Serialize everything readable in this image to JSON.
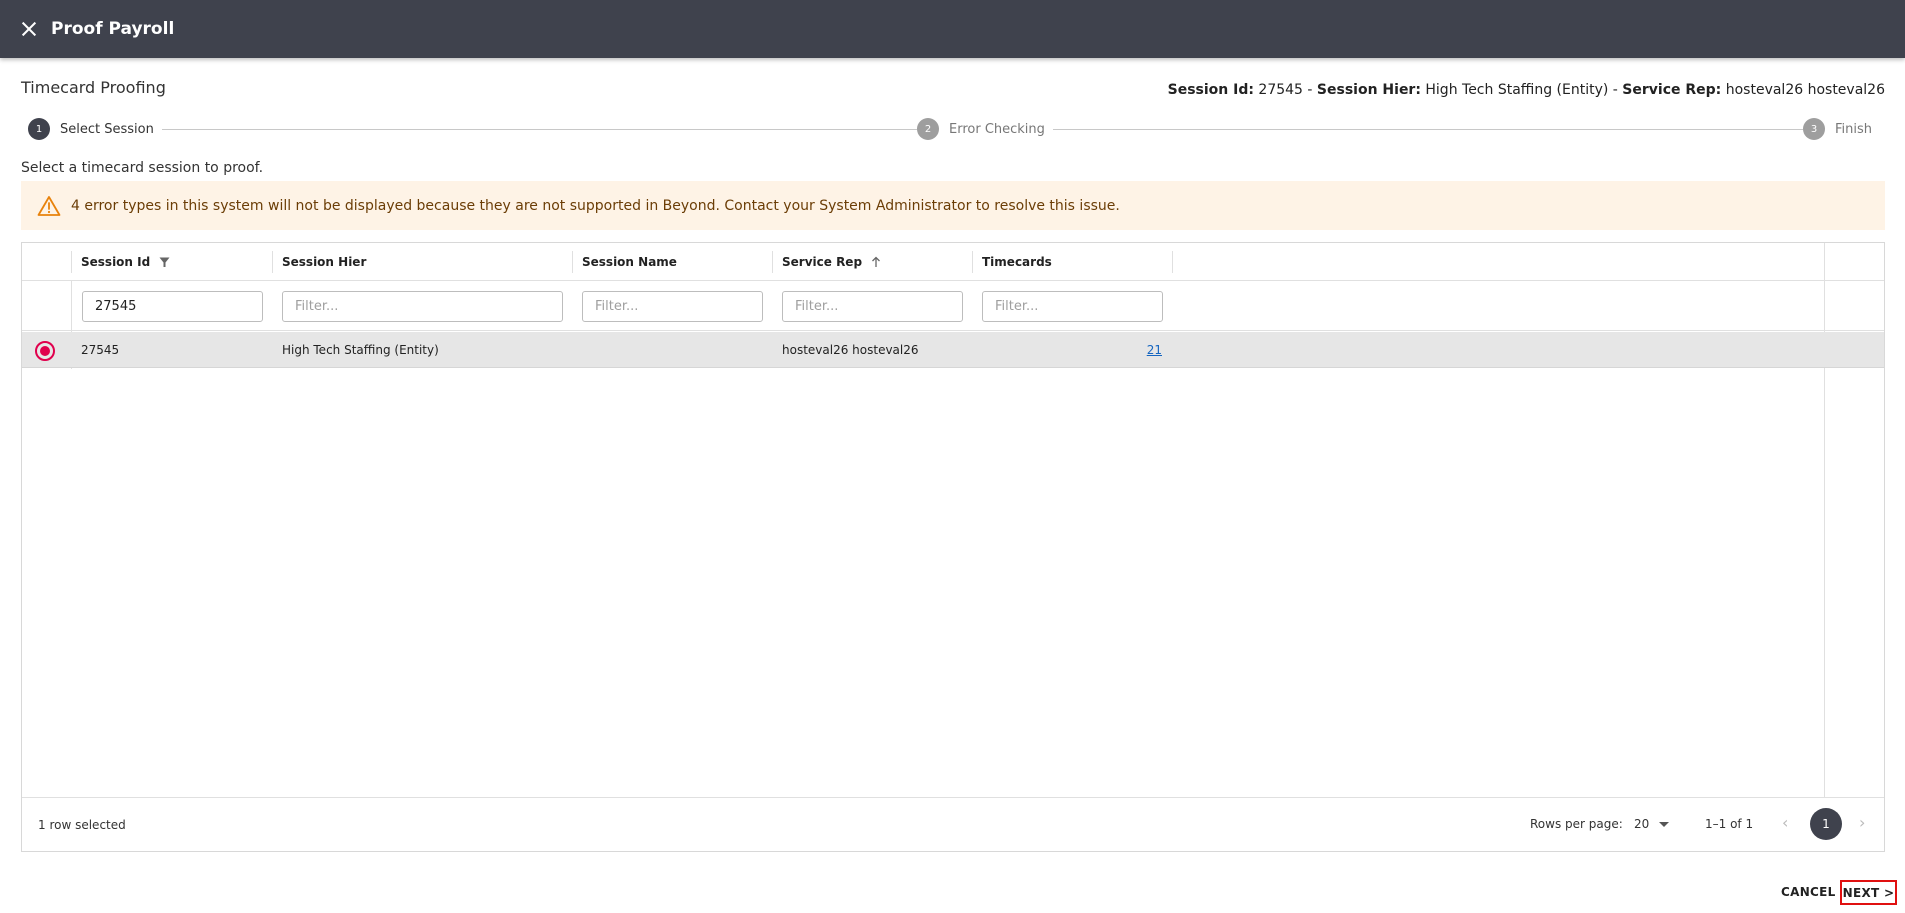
{
  "header": {
    "title": "Proof Payroll",
    "close_icon": "close-icon"
  },
  "page": {
    "section_title": "Timecard Proofing",
    "session_info": {
      "session_id_label": "Session Id:",
      "session_id_value": "27545",
      "separator": "-",
      "session_hier_label": "Session Hier:",
      "session_hier_value": "High Tech Staffing (Entity)",
      "service_rep_label": "Service Rep:",
      "service_rep_value": "hosteval26 hosteval26"
    },
    "stepper": [
      {
        "number": "1",
        "label": "Select Session",
        "state": "active"
      },
      {
        "number": "2",
        "label": "Error Checking",
        "state": "inactive"
      },
      {
        "number": "3",
        "label": "Finish",
        "state": "inactive"
      }
    ],
    "instruction": "Select a timecard session to proof.",
    "warning": {
      "icon": "warning-icon",
      "text": "4 error types in this system will not be displayed because they are not supported in Beyond. Contact your System Administrator to resolve this issue.",
      "bg_color": "#fef3e6",
      "icon_color": "#e8820c"
    }
  },
  "grid": {
    "columns": [
      {
        "label": "Session Id",
        "icon": "filter-icon"
      },
      {
        "label": "Session Hier",
        "icon": ""
      },
      {
        "label": "Session Name",
        "icon": ""
      },
      {
        "label": "Service Rep",
        "icon": "sort-ascending-icon"
      },
      {
        "label": "Timecards",
        "icon": ""
      }
    ],
    "filters": {
      "session_id_value": "27545",
      "placeholder": "Filter..."
    },
    "rows": [
      {
        "selected": true,
        "session_id": "27545",
        "session_hier": "High Tech Staffing (Entity)",
        "session_name": "",
        "service_rep": "hosteval26 hosteval26",
        "timecards": "21"
      }
    ],
    "footer": {
      "selected_count": "1 row selected",
      "rows_per_page_label": "Rows per page:",
      "rows_per_page_value": "20",
      "page_range": "1–1 of 1",
      "current_page": "1"
    }
  },
  "actions": {
    "cancel_label": "CANCEL",
    "next_label": "NEXT >"
  },
  "colors": {
    "topbar": "#3f424d",
    "radio_accent": "#e0004d",
    "link": "#1565c0",
    "next_highlight": "#e01010"
  }
}
